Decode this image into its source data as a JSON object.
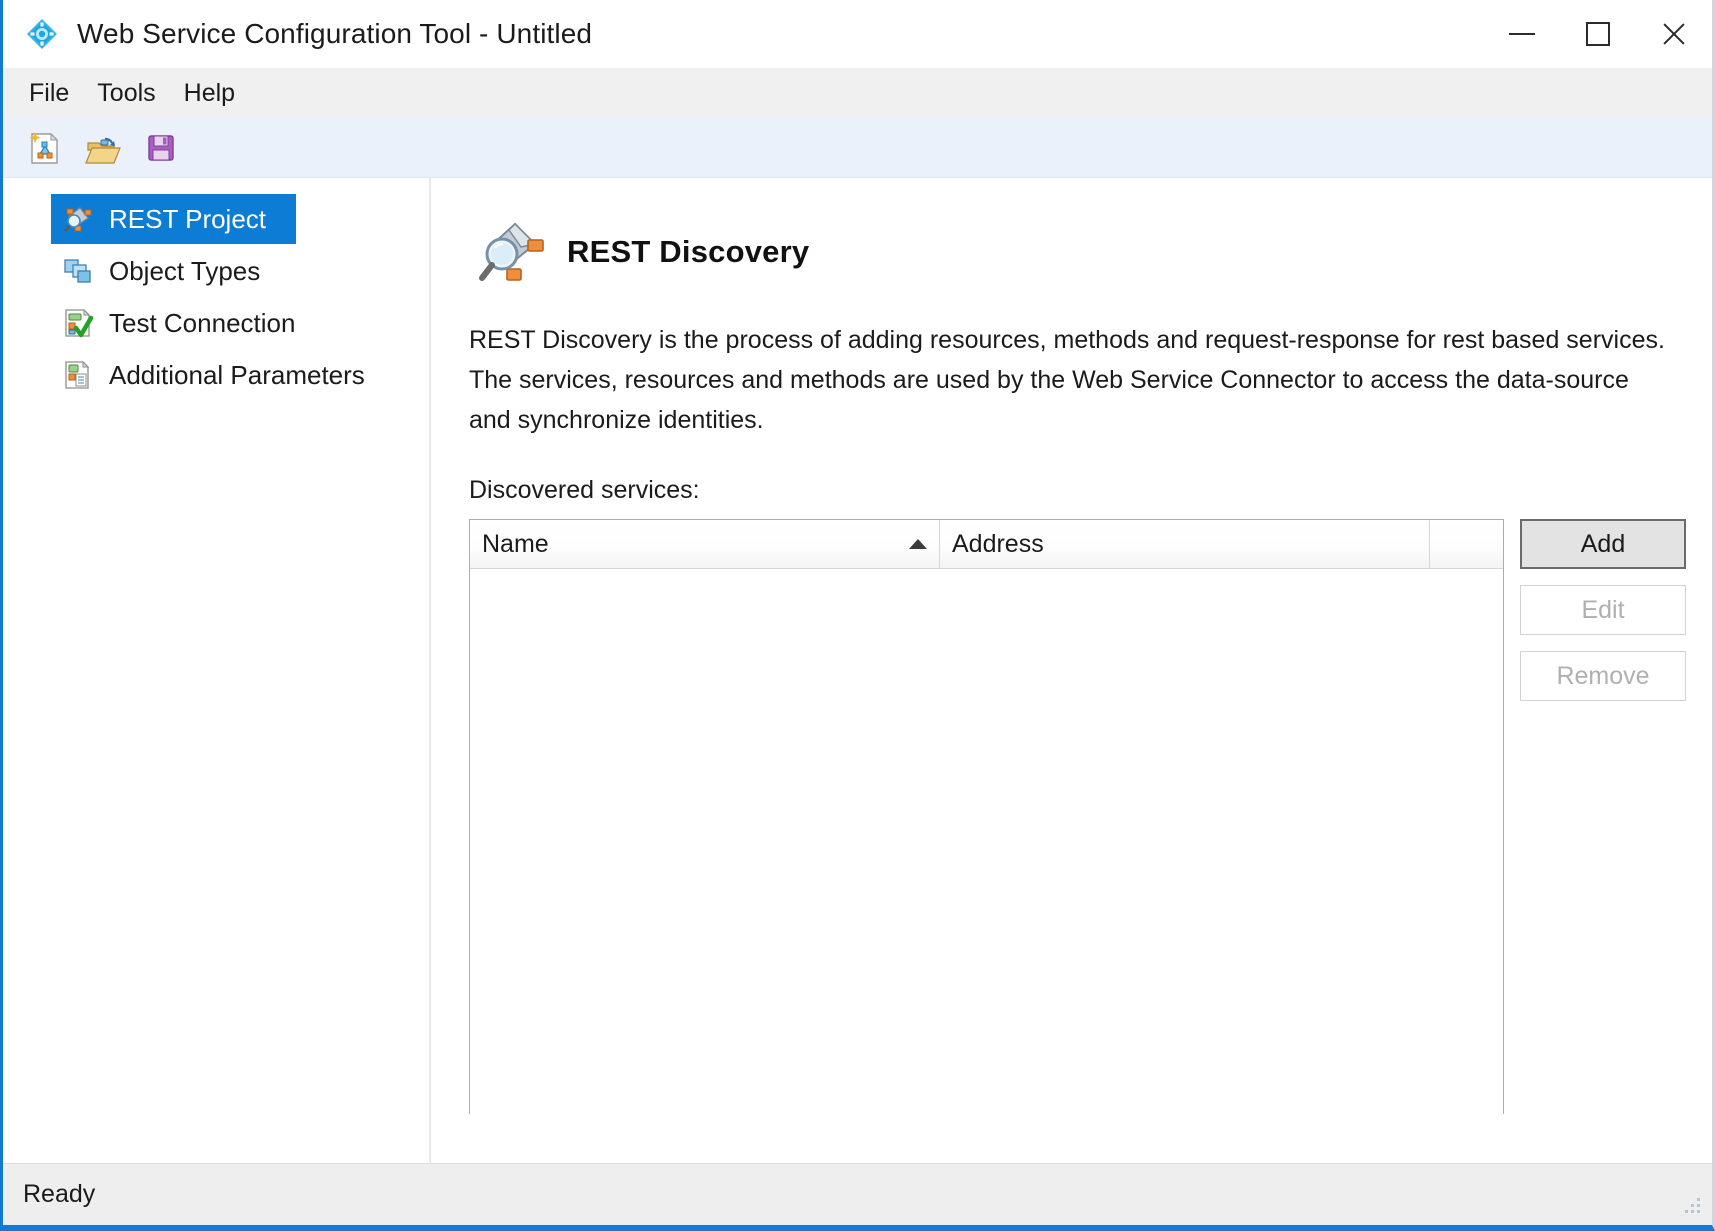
{
  "window": {
    "title": "Web Service Configuration Tool - Untitled",
    "app_icon": "diamond-app-icon",
    "controls": {
      "minimize": "minimize-icon",
      "maximize": "maximize-icon",
      "close": "close-icon"
    },
    "accent_color": "#1379d6"
  },
  "menubar": {
    "items": [
      {
        "label": "File"
      },
      {
        "label": "Tools"
      },
      {
        "label": "Help"
      }
    ]
  },
  "toolbar": {
    "buttons": [
      {
        "icon": "new-project-icon",
        "tooltip": "New"
      },
      {
        "icon": "open-folder-icon",
        "tooltip": "Open"
      },
      {
        "icon": "save-floppy-icon",
        "tooltip": "Save"
      }
    ]
  },
  "sidebar": {
    "items": [
      {
        "label": "REST Project",
        "icon": "rest-project-icon",
        "selected": true
      },
      {
        "label": "Object Types",
        "icon": "object-types-icon",
        "selected": false
      },
      {
        "label": "Test Connection",
        "icon": "test-connection-icon",
        "selected": false
      },
      {
        "label": "Additional Parameters",
        "icon": "additional-parameters-icon",
        "selected": false
      }
    ],
    "selected_background": "#0c7cd5"
  },
  "content": {
    "page_icon": "rest-discovery-icon",
    "page_title": "REST Discovery",
    "description": "REST Discovery is the process of adding resources, methods and request-response for rest based services. The services, resources and methods are used by the Web Service Connector to access the data-source and synchronize identities.",
    "list_label": "Discovered services:",
    "table": {
      "columns": [
        {
          "header": "Name",
          "sorted": "ascending"
        },
        {
          "header": "Address",
          "sorted": "none"
        },
        {
          "header": "",
          "sorted": "none"
        }
      ],
      "rows": []
    },
    "buttons": [
      {
        "label": "Add",
        "enabled": true,
        "default": true
      },
      {
        "label": "Edit",
        "enabled": false,
        "default": false
      },
      {
        "label": "Remove",
        "enabled": false,
        "default": false
      }
    ]
  },
  "statusbar": {
    "text": "Ready",
    "grip": "resize-grip-icon"
  }
}
